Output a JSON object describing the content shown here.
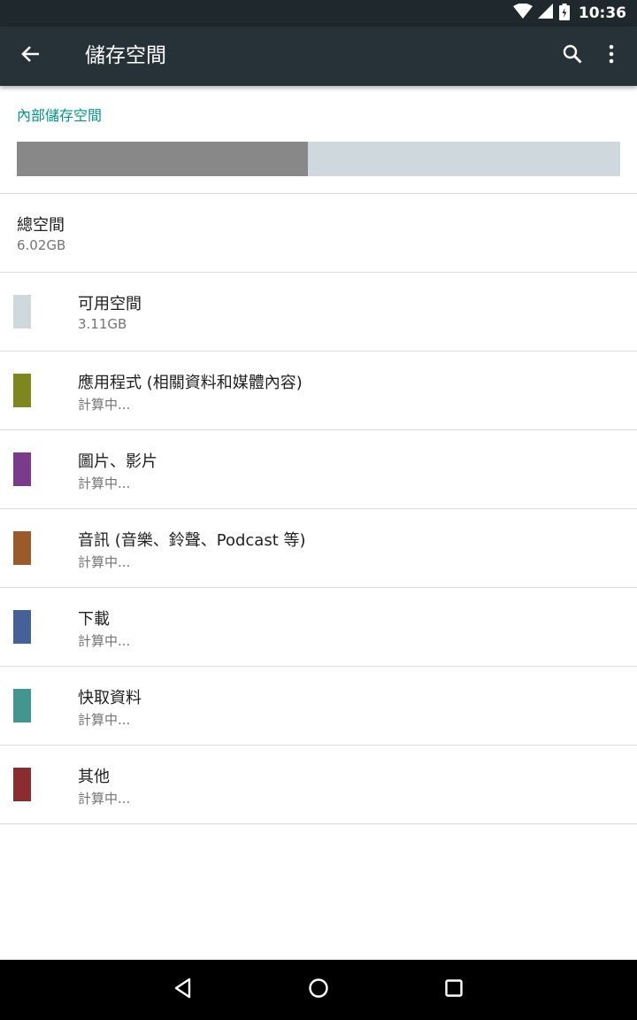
{
  "status_bar": {
    "time": "10:36",
    "icons": [
      "wifi-icon",
      "cell-signal-icon",
      "battery-icon"
    ]
  },
  "toolbar": {
    "title": "儲存空間",
    "back_icon": "arrow-back-icon",
    "search_icon": "search-icon",
    "more_icon": "more-vert-icon"
  },
  "storage": {
    "section_title": "內部儲存空間",
    "used_fraction": 0.4828,
    "used_color": "#888888",
    "free_color": "#cfd8dc",
    "total_label": "總空間",
    "total_value": "6.02GB"
  },
  "items": [
    {
      "label": "可用空間",
      "detail": "3.11GB",
      "color": "#cfd8dc"
    },
    {
      "label": "應用程式 (相關資料和媒體內容)",
      "detail": "計算中...",
      "color": "#7d861f"
    },
    {
      "label": "圖片、影片",
      "detail": "計算中...",
      "color": "#7b3a8c"
    },
    {
      "label": "音訊 (音樂、鈴聲、Podcast 等)",
      "detail": "計算中...",
      "color": "#9a5a2a"
    },
    {
      "label": "下載",
      "detail": "計算中...",
      "color": "#46609a"
    },
    {
      "label": "快取資料",
      "detail": "計算中...",
      "color": "#43958f"
    },
    {
      "label": "其他",
      "detail": "計算中...",
      "color": "#8a2c30"
    }
  ],
  "nav": {
    "back_icon": "nav-back-icon",
    "home_icon": "nav-home-icon",
    "recents_icon": "nav-recents-icon"
  },
  "colors": {
    "accent": "#00968a",
    "toolbar": "#263238",
    "status_bar": "#1f282d"
  }
}
